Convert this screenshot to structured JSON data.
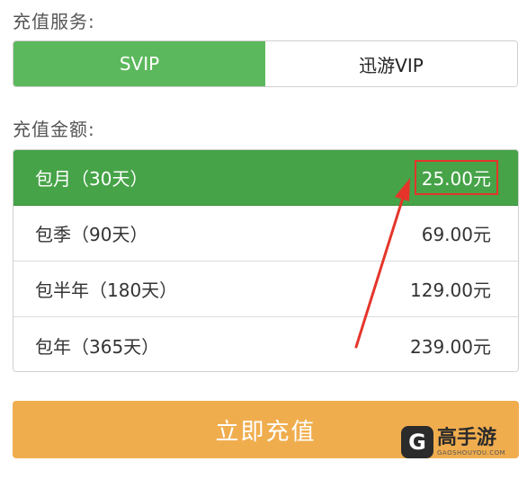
{
  "service": {
    "label": "充值服务:",
    "tabs": [
      {
        "label": "SVIP",
        "selected": true
      },
      {
        "label": "迅游VIP",
        "selected": false
      }
    ]
  },
  "amount": {
    "label": "充值金额:",
    "options": [
      {
        "plan": "包月（30天）",
        "price": "25.00元",
        "selected": true
      },
      {
        "plan": "包季（90天）",
        "price": "69.00元",
        "selected": false
      },
      {
        "plan": "包半年（180天）",
        "price": "129.00元",
        "selected": false
      },
      {
        "plan": "包年（365天）",
        "price": "239.00元",
        "selected": false
      }
    ]
  },
  "recharge_button": {
    "label": "立即充值"
  },
  "watermark": {
    "logo_glyph": "G",
    "name": "高手游",
    "domain": "GAOSHOUYOU.COM"
  },
  "colors": {
    "selected_green": "#46a348",
    "tab_green": "#5cb85c",
    "button_orange": "#f0ad4e",
    "highlight_red": "#e5352a"
  }
}
